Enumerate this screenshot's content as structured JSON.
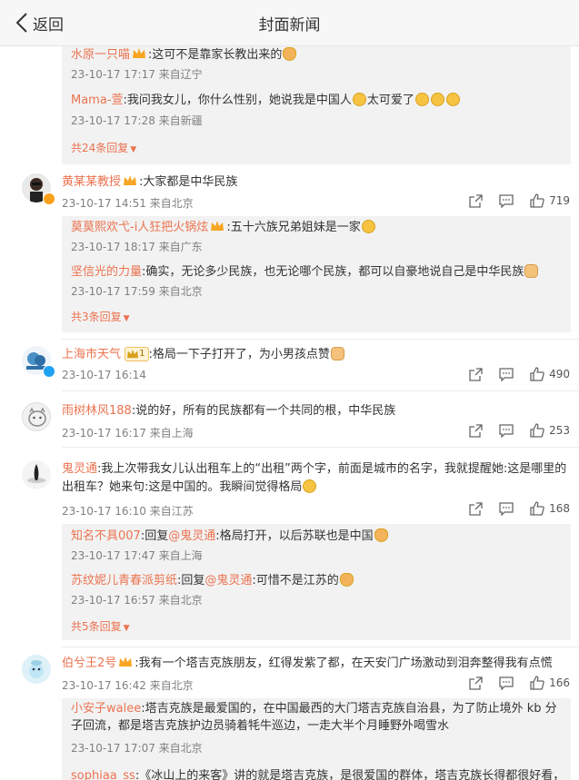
{
  "header": {
    "back_label": "返回",
    "title": "封面新闻"
  },
  "thread0": {
    "replies": [
      {
        "name": "水原一只喵",
        "text": ":这可不是靠家长教出来的",
        "meta": "23-10-17 17:17 来自辽宁",
        "emoji": "cat-emoji"
      },
      {
        "name": "Mama-萱",
        "text": ":我问我女儿，你什么性别，她说我是中国人",
        "text2": "太可爱了",
        "meta": "23-10-17 17:28 来自新疆"
      }
    ],
    "more": "共24条回复"
  },
  "c1": {
    "name": "黄某某教授",
    "text": ":大家都是中华民族",
    "meta": "23-10-17 14:51 来自北京",
    "likes": "719",
    "replies": [
      {
        "name": "莫莫熙欢弋-i人狂把火锅炫",
        "text": ":五十六族兄弟姐妹是一家",
        "meta": "23-10-17 18:17 来自广东"
      },
      {
        "name": "坚信光的力量",
        "text": ":确实，无论多少民族，也无论哪个民族，都可以自豪地说自己是中华民族",
        "meta": "23-10-17 17:59 来自北京"
      }
    ],
    "more": "共3条回复"
  },
  "c2": {
    "name": "上海市天气",
    "level": "1",
    "text": ":格局一下子打开了，为小男孩点赞",
    "meta": "23-10-17 16:14",
    "likes": "490"
  },
  "c3": {
    "name": "雨树林风188",
    "text": ":说的好，所有的民族都有一个共同的根，中华民族",
    "meta": "23-10-17 16:17 来自上海",
    "likes": "253"
  },
  "c4": {
    "name": "鬼灵通",
    "text": ":我上次带我女儿认出租车上的“出租”两个字，前面是城市的名字，我就提醒她:这是哪里的出租车？她来句:这是中国的。我瞬间觉得格局",
    "meta": "23-10-17 16:10 来自江苏",
    "likes": "168",
    "replies": [
      {
        "name": "知名不具007",
        "pre": ":回复",
        "at": "@鬼灵通",
        "text": ":格局打开，以后苏联也是中国",
        "meta": "23-10-17 17:47 来自上海"
      },
      {
        "name": "苏纹妮儿青春派剪纸",
        "pre": ":回复",
        "at": "@鬼灵通",
        "text": ":可惜不是江苏的",
        "meta": "23-10-17 16:57 来自北京"
      }
    ],
    "more": "共5条回复"
  },
  "c5": {
    "name": "伯兮王2号",
    "text": ":我有一个塔吉克族朋友，红得发紫了都，在天安门广场激动到泪奔整得我有点慌",
    "meta": "23-10-17 16:42 来自北京",
    "likes": "166",
    "replies": [
      {
        "name": "小安子walee",
        "text": ":塔吉克族是最爱国的，在中国最西的大门塔吉克族自治县，为了防止境外 kb 分子回流，都是塔吉克族护边员骑着牦牛巡边，一走大半个月睡野外喝雪水",
        "meta": "23-10-17 17:07 来自北京"
      },
      {
        "name": "sophiaa_ss",
        "text": ":《冰山上的来客》讲的就是塔吉克族，是很爱国的群体，塔吉克族长得都很好看，"
      }
    ]
  },
  "colors": {
    "accent": "#eb7350",
    "meta": "#808080",
    "reply_bg": "#f2f2f2"
  }
}
